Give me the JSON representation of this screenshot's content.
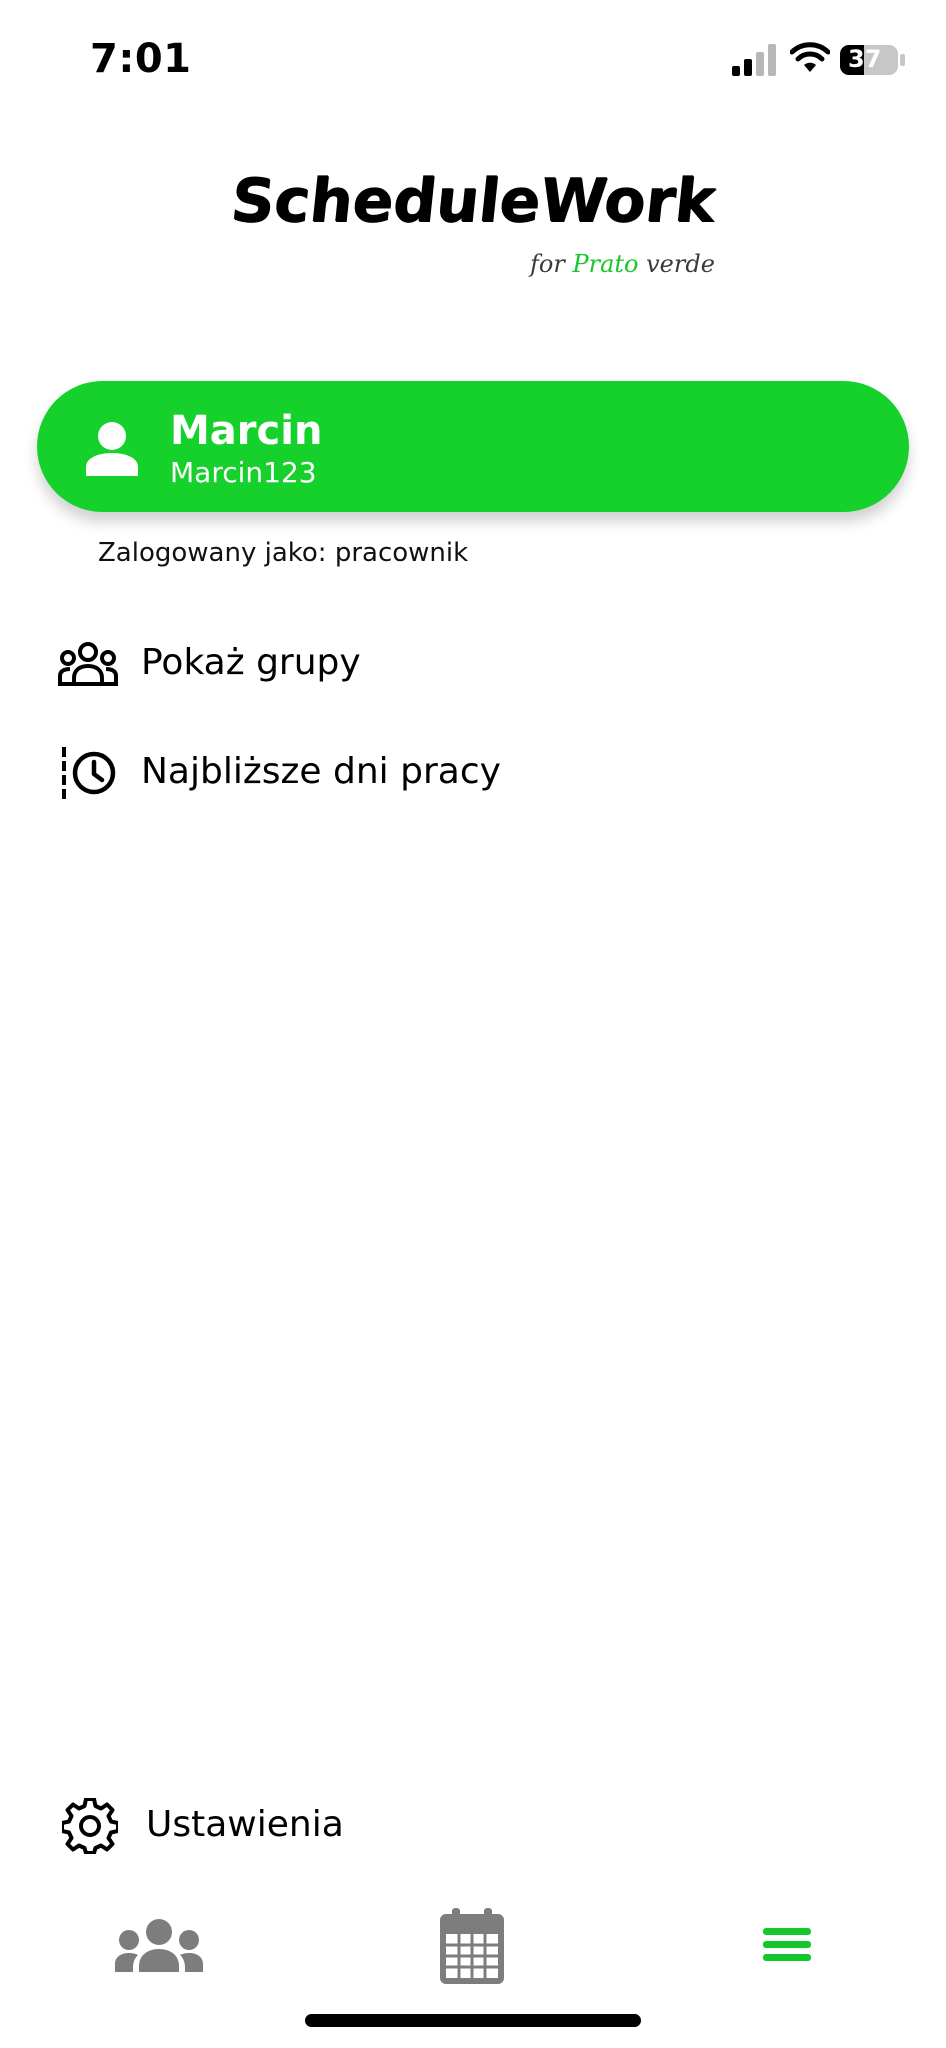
{
  "status_bar": {
    "time": "7:01",
    "battery": "37"
  },
  "logo": {
    "title": "ScheduleWork",
    "sub_prefix": "for",
    "sub_brand": "Prato",
    "sub_suffix": "verde"
  },
  "profile": {
    "name": "Marcin",
    "username": "Marcin123",
    "role_text": "Zalogowany jako: pracownik"
  },
  "menu": {
    "items": [
      {
        "label": "Pokaż grupy",
        "icon": "groups-icon"
      },
      {
        "label": "Najbliższe dni pracy",
        "icon": "history-clock-icon"
      }
    ],
    "settings": {
      "label": "Ustawienia",
      "icon": "gear-icon"
    }
  },
  "tabbar": {
    "tabs": [
      {
        "name": "groups",
        "icon": "groups-icon",
        "active": false
      },
      {
        "name": "calendar",
        "icon": "calendar-icon",
        "active": false
      },
      {
        "name": "menu",
        "icon": "hamburger-icon",
        "active": true
      }
    ]
  },
  "colors": {
    "accent": "#16d12b",
    "inactive_tab": "#7d7d7d",
    "text": "#000000"
  }
}
